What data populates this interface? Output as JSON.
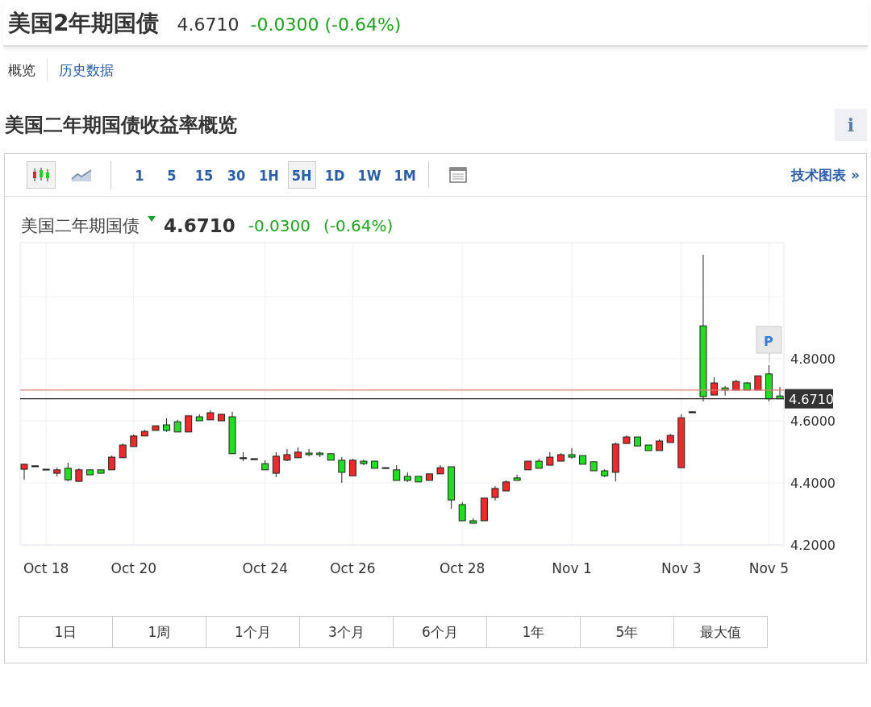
{
  "header": {
    "title": "美国2年期国债",
    "price": "4.6710",
    "change": "-0.0300 (-0.64%)"
  },
  "tabs": [
    {
      "label": "概览",
      "selected": true
    },
    {
      "label": "历史数据",
      "selected": false
    }
  ],
  "section": {
    "title": "美国二年期国债收益率概览",
    "info": "i"
  },
  "toolbar": {
    "chart_types": [
      {
        "kind": "candlestick",
        "selected": true
      },
      {
        "kind": "line",
        "selected": false
      }
    ],
    "intervals": [
      {
        "label": "1",
        "selected": false
      },
      {
        "label": "5",
        "selected": false
      },
      {
        "label": "15",
        "selected": false
      },
      {
        "label": "30",
        "selected": false
      },
      {
        "label": "1H",
        "selected": false
      },
      {
        "label": "5H",
        "selected": true
      },
      {
        "label": "1D",
        "selected": false
      },
      {
        "label": "1W",
        "selected": false
      },
      {
        "label": "1M",
        "selected": false
      }
    ],
    "link": "技术图表 »"
  },
  "quote": {
    "name": "美国二年期国债",
    "price": "4.6710",
    "change": "-0.0300",
    "percent": "(-0.64%)"
  },
  "chart": {
    "marker": "P",
    "chart_data": {
      "type": "candlestick",
      "categories": [
        null,
        null,
        "Oct 18",
        null,
        null,
        null,
        null,
        null,
        null,
        null,
        "Oct 20",
        null,
        null,
        null,
        null,
        null,
        null,
        null,
        null,
        null,
        null,
        null,
        "Oct 24",
        null,
        null,
        null,
        null,
        null,
        null,
        null,
        "Oct 26",
        null,
        null,
        null,
        null,
        null,
        null,
        null,
        null,
        null,
        "Oct 28",
        null,
        null,
        null,
        null,
        null,
        null,
        null,
        null,
        null,
        "Nov 1",
        null,
        null,
        null,
        null,
        null,
        null,
        null,
        null,
        null,
        "Nov 3",
        null,
        null,
        null,
        null,
        null,
        null,
        null,
        "Nov 5",
        null
      ],
      "ohlc": [
        [
          4.444,
          4.462,
          4.41,
          4.46
        ],
        [
          4.455,
          4.455,
          4.452,
          4.452
        ],
        [
          4.444,
          4.444,
          4.442,
          4.442
        ],
        [
          4.431,
          4.449,
          4.421,
          4.442
        ],
        [
          4.447,
          4.465,
          4.405,
          4.41
        ],
        [
          4.405,
          4.447,
          4.403,
          4.442
        ],
        [
          4.442,
          4.442,
          4.426,
          4.426
        ],
        [
          4.442,
          4.442,
          4.431,
          4.431
        ],
        [
          4.442,
          4.488,
          4.442,
          4.483
        ],
        [
          4.481,
          4.527,
          4.481,
          4.522
        ],
        [
          4.517,
          4.556,
          4.517,
          4.551
        ],
        [
          4.551,
          4.571,
          4.551,
          4.566
        ],
        [
          4.569,
          4.584,
          4.569,
          4.584
        ],
        [
          4.587,
          4.608,
          4.564,
          4.569
        ],
        [
          4.597,
          4.603,
          4.564,
          4.564
        ],
        [
          4.564,
          4.616,
          4.564,
          4.616
        ],
        [
          4.613,
          4.621,
          4.6,
          4.6
        ],
        [
          4.603,
          4.634,
          4.603,
          4.626
        ],
        [
          4.6,
          4.621,
          4.6,
          4.621
        ],
        [
          4.613,
          4.629,
          4.494,
          4.494
        ],
        [
          4.481,
          4.499,
          4.47,
          4.478
        ],
        [
          4.478,
          4.478,
          4.475,
          4.475
        ],
        [
          4.462,
          4.473,
          4.442,
          4.442
        ],
        [
          4.431,
          4.499,
          4.418,
          4.486
        ],
        [
          4.473,
          4.509,
          4.47,
          4.491
        ],
        [
          4.481,
          4.514,
          4.481,
          4.499
        ],
        [
          4.496,
          4.509,
          4.486,
          4.491
        ],
        [
          4.496,
          4.501,
          4.483,
          4.491
        ],
        [
          4.494,
          4.494,
          4.473,
          4.473
        ],
        [
          4.473,
          4.483,
          4.4,
          4.434
        ],
        [
          4.423,
          4.478,
          4.423,
          4.473
        ],
        [
          4.47,
          4.475,
          4.457,
          4.462
        ],
        [
          4.47,
          4.47,
          4.447,
          4.447
        ],
        [
          4.449,
          4.449,
          4.447,
          4.447
        ],
        [
          4.442,
          4.457,
          4.408,
          4.408
        ],
        [
          4.421,
          4.434,
          4.403,
          4.408
        ],
        [
          4.421,
          4.421,
          4.403,
          4.403
        ],
        [
          4.408,
          4.429,
          4.408,
          4.429
        ],
        [
          4.429,
          4.457,
          4.429,
          4.449
        ],
        [
          4.452,
          4.452,
          4.317,
          4.345
        ],
        [
          4.33,
          4.338,
          4.278,
          4.278
        ],
        [
          4.278,
          4.286,
          4.27,
          4.27
        ],
        [
          4.278,
          4.351,
          4.278,
          4.351
        ],
        [
          4.353,
          4.39,
          4.343,
          4.382
        ],
        [
          4.374,
          4.408,
          4.374,
          4.403
        ],
        [
          4.416,
          4.426,
          4.408,
          4.408
        ],
        [
          4.442,
          4.47,
          4.442,
          4.47
        ],
        [
          4.47,
          4.478,
          4.447,
          4.447
        ],
        [
          4.457,
          4.499,
          4.457,
          4.483
        ],
        [
          4.47,
          4.496,
          4.47,
          4.491
        ],
        [
          4.491,
          4.512,
          4.478,
          4.483
        ],
        [
          4.488,
          4.488,
          4.46,
          4.46
        ],
        [
          4.468,
          4.468,
          4.439,
          4.439
        ],
        [
          4.439,
          4.444,
          4.418,
          4.423
        ],
        [
          4.434,
          4.53,
          4.405,
          4.525
        ],
        [
          4.527,
          4.553,
          4.527,
          4.548
        ],
        [
          4.548,
          4.548,
          4.519,
          4.519
        ],
        [
          4.522,
          4.522,
          4.504,
          4.504
        ],
        [
          4.504,
          4.54,
          4.504,
          4.535
        ],
        [
          4.53,
          4.558,
          4.53,
          4.553
        ],
        [
          4.449,
          4.621,
          4.449,
          4.61
        ],
        [
          4.629,
          4.629,
          4.626,
          4.626
        ],
        [
          4.906,
          5.135,
          4.662,
          4.678
        ],
        [
          4.683,
          4.74,
          4.683,
          4.722
        ],
        [
          4.706,
          4.712,
          4.681,
          4.699
        ],
        [
          4.699,
          4.732,
          4.699,
          4.727
        ],
        [
          4.722,
          4.725,
          4.699,
          4.699
        ],
        [
          4.699,
          4.745,
          4.699,
          4.745
        ],
        [
          4.751,
          4.779,
          4.662,
          4.671
        ],
        [
          4.68,
          4.709,
          4.671,
          4.671
        ]
      ],
      "grid": true,
      "ref_lines": [
        {
          "axis": "y",
          "value": 4.699,
          "color": "#ee7777"
        },
        {
          "axis": "y",
          "value": 4.671,
          "color": "#222222",
          "label": "4.6710"
        }
      ],
      "ylim": [
        4.2,
        5.174
      ],
      "yticks": [
        {
          "value": 4.8,
          "label": "4.8000"
        },
        {
          "value": 4.6,
          "label": "4.6000"
        },
        {
          "value": 4.4,
          "label": "4.4000"
        },
        {
          "value": 4.2,
          "label": "4.2000"
        }
      ]
    }
  },
  "ranges": [
    {
      "label": "1日",
      "selected": false
    },
    {
      "label": "1周",
      "selected": false
    },
    {
      "label": "1个月",
      "selected": false
    },
    {
      "label": "3个月",
      "selected": false
    },
    {
      "label": "6个月",
      "selected": false
    },
    {
      "label": "1年",
      "selected": false
    },
    {
      "label": "5年",
      "selected": false
    },
    {
      "label": "最大值",
      "selected": false
    }
  ]
}
